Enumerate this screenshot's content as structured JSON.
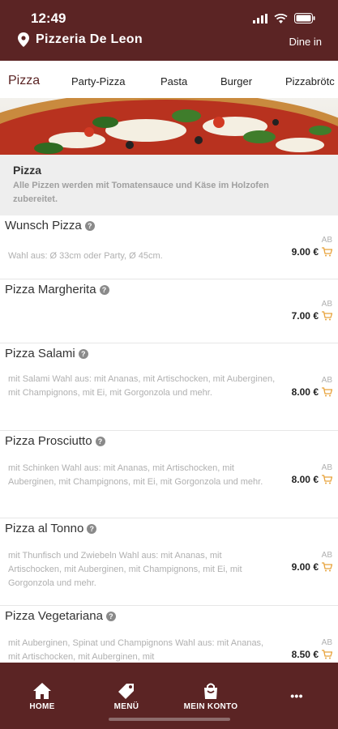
{
  "status": {
    "time": "12:49"
  },
  "header": {
    "restaurant": "Pizzeria De Leon",
    "mode": "Dine in"
  },
  "tabs": [
    "Pizza",
    "Party-Pizza",
    "Pasta",
    "Burger",
    "Pizzabrötc"
  ],
  "category": {
    "title": "Pizza",
    "description": "Alle Pizzen werden mit Tomatensauce und Käse im Holzofen zubereitet."
  },
  "items": [
    {
      "name": "Wunsch Pizza",
      "desc": "Wahl aus: Ø 33cm oder Party, Ø 45cm.",
      "ab": "AB",
      "price": "9.00 €"
    },
    {
      "name": "Pizza Margherita",
      "desc": "",
      "ab": "AB",
      "price": "7.00 €"
    },
    {
      "name": "Pizza Salami",
      "desc": "mit Salami Wahl aus: mit Ananas, mit Artischocken, mit Auberginen, mit Champignons, mit Ei, mit Gorgonzola und mehr.",
      "ab": "AB",
      "price": "8.00 €"
    },
    {
      "name": "Pizza Prosciutto",
      "desc": "mit Schinken Wahl aus: mit Ananas, mit Artischocken, mit Auberginen, mit Champignons, mit Ei, mit Gorgonzola und mehr.",
      "ab": "AB",
      "price": "8.00 €"
    },
    {
      "name": "Pizza al Tonno",
      "desc": "mit Thunfisch und Zwiebeln Wahl aus: mit Ananas, mit Artischocken, mit Auberginen, mit Champignons, mit Ei, mit Gorgonzola und mehr.",
      "ab": "AB",
      "price": "9.00 €"
    },
    {
      "name": "Pizza Vegetariana",
      "desc": "mit Auberginen, Spinat und Champignons Wahl aus: mit Ananas, mit Artischocken, mit Auberginen, mit",
      "ab": "AB",
      "price": "8.50 €"
    }
  ],
  "nav": {
    "home": "HOME",
    "menu": "MENÜ",
    "account": "MEIN KONTO",
    "more": "•••"
  },
  "colors": {
    "brand": "#5b2424",
    "cart": "#e8a23a"
  },
  "icons": [
    "wifi-icon",
    "battery-icon",
    "location-pin-icon",
    "info-icon",
    "cart-icon",
    "home-icon",
    "tag-icon",
    "bag-icon",
    "more-icon"
  ]
}
